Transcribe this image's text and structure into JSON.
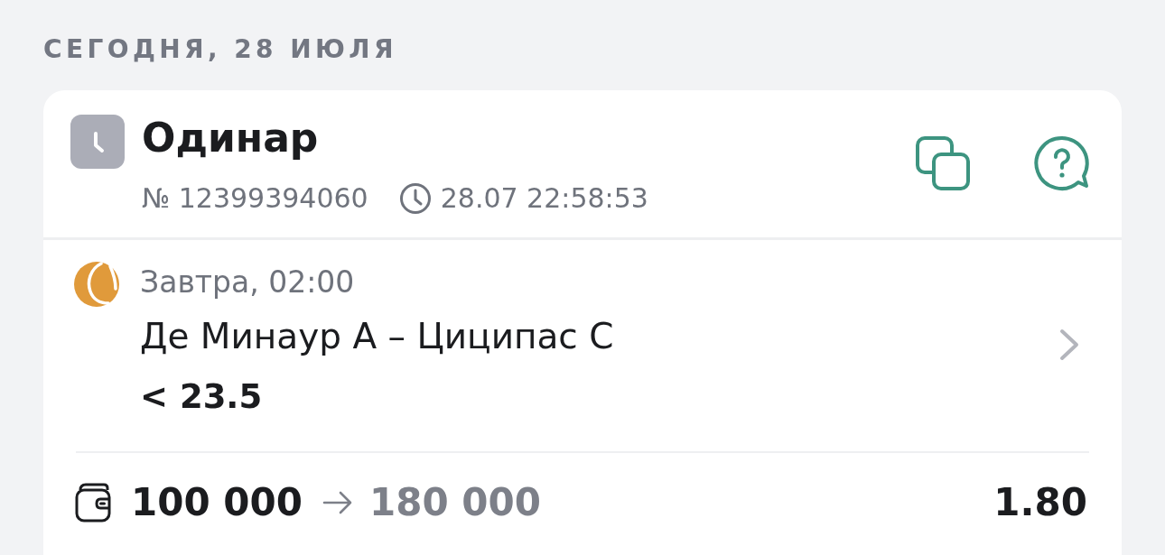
{
  "date_header": "СЕГОДНЯ, 28 ИЮЛЯ",
  "bet": {
    "pending": true,
    "type": "Одинар",
    "number": "№ 12399394060",
    "placed_at": "28.07 22:58:53"
  },
  "event": {
    "start": "Завтра, 02:00",
    "match": "Де Минаур А – Циципас С",
    "outcome": "< 23.5"
  },
  "summary": {
    "stake": "100 000",
    "payout": "180 000",
    "odds": "1.80"
  }
}
